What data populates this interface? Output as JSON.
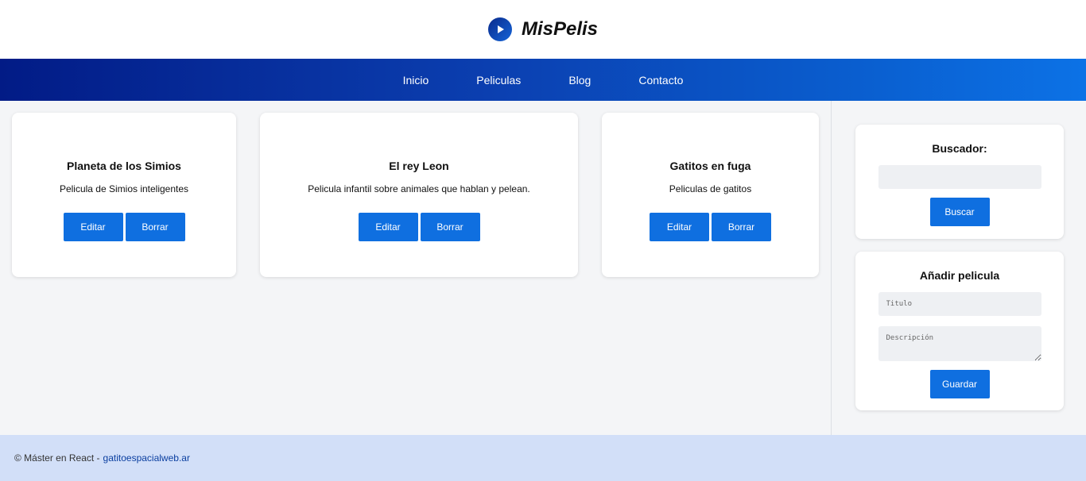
{
  "header": {
    "brand": "MisPelis",
    "logo_icon": "play-icon"
  },
  "nav": {
    "items": [
      "Inicio",
      "Peliculas",
      "Blog",
      "Contacto"
    ]
  },
  "movies": [
    {
      "title": "Planeta de los Simios",
      "description": "Pelicula de Simios inteligentes",
      "edit_label": "Editar",
      "delete_label": "Borrar"
    },
    {
      "title": "El rey Leon",
      "description": "Pelicula infantil sobre animales que hablan y pelean.",
      "edit_label": "Editar",
      "delete_label": "Borrar"
    },
    {
      "title": "Gatitos en fuga",
      "description": "Peliculas de gatitos",
      "edit_label": "Editar",
      "delete_label": "Borrar"
    }
  ],
  "search": {
    "title": "Buscador:",
    "value": "",
    "placeholder": "",
    "button_label": "Buscar"
  },
  "add": {
    "title": "Añadir pelicula",
    "title_placeholder": "Titulo",
    "description_placeholder": "Descripción",
    "button_label": "Guardar"
  },
  "footer": {
    "text": "© Máster en React -",
    "link": "gatitoespacialweb.ar"
  },
  "colors": {
    "accent": "#0f6fe0",
    "nav_start": "#021b86",
    "nav_end": "#0c72e6",
    "footer_bg": "#d2dff8"
  }
}
